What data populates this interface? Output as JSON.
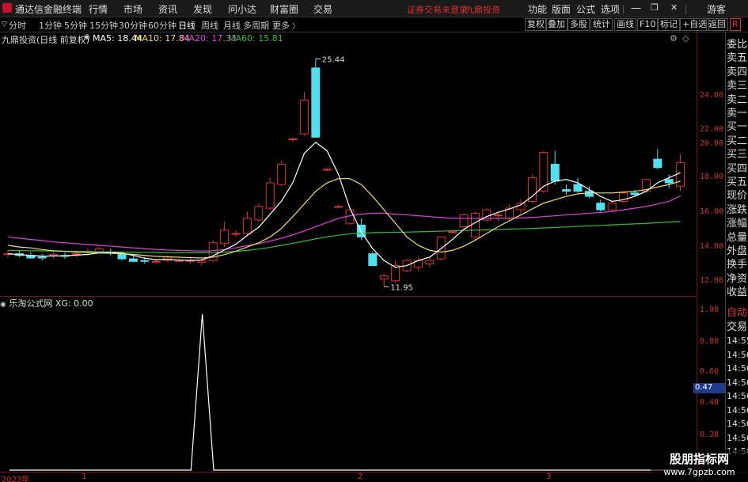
{
  "app": {
    "name": "通达信金融终端",
    "menus": [
      "行情",
      "市场",
      "资讯",
      "发现",
      "问小达",
      "财富圈",
      "交易"
    ],
    "warning": "证券交易未登录",
    "broker": "九鼎投资",
    "right_menus": [
      "功能",
      "版面",
      "公式",
      "选项"
    ],
    "user": "游客",
    "r_badge": "R"
  },
  "toolbar": {
    "periods": [
      "分时",
      "1分钟",
      "5分钟",
      "15分钟",
      "30分钟",
      "60分钟",
      "日线",
      "周线",
      "月线",
      "多周期",
      "更多"
    ],
    "active_period": "日线",
    "right_buttons": [
      "复权",
      "叠加",
      "多股",
      "统计",
      "画线",
      "F10",
      "标记",
      "+自选",
      "返回"
    ]
  },
  "info": {
    "title": "九鼎投资(日线 前复权)",
    "ma5": "MA5: 18.44",
    "ma10": "MA10: 17.84",
    "ma20": "MA20: 17.33",
    "ma60": "MA60: 15.81"
  },
  "colors": {
    "ma5": "#ffffff",
    "ma10": "#f0e060",
    "ma20": "#e040e0",
    "ma60": "#30c030",
    "up": "#e03030",
    "down": "#50e0f0",
    "axis": "#d03030"
  },
  "axis_labels": {
    "main": [
      "24.00",
      "22.00",
      "20.00",
      "18.00",
      "16.00",
      "14.00",
      "12.00"
    ],
    "sub": [
      "1.00",
      "0.80",
      "0.60",
      "0.40",
      "0.20"
    ]
  },
  "annotations": {
    "high": "25.44",
    "low": "11.95"
  },
  "sub": {
    "title": "乐淘公式网 XG: 0.00",
    "cursor_value": "0.47"
  },
  "side_panel": {
    "items": [
      "委比",
      "卖五",
      "卖四",
      "卖三",
      "卖二",
      "卖一",
      "买一",
      "买二",
      "买三",
      "买四",
      "买五",
      "现价",
      "涨跌",
      "涨幅",
      "总量",
      "外盘",
      "换手",
      "净资",
      "收益"
    ],
    "auto_label": "自动",
    "trade_label": "交易",
    "times": [
      "14:55",
      "14:56",
      "14:56",
      "14:56",
      "14:56",
      "14:56",
      "14:56",
      "14:56",
      "14:56"
    ]
  },
  "dates": [
    "2023年",
    "1",
    "2",
    "3"
  ],
  "watermark": {
    "line1": "股朋指标网",
    "line2": "www.7gpzb.com"
  },
  "chart_data": {
    "type": "candlestick",
    "ylim": [
      11.4,
      26.3
    ],
    "candles": [
      {
        "o": 13.9,
        "h": 14.1,
        "l": 13.7,
        "c": 13.9
      },
      {
        "o": 13.9,
        "h": 14.1,
        "l": 13.7,
        "c": 13.8
      },
      {
        "o": 13.8,
        "h": 14.0,
        "l": 13.6,
        "c": 13.65
      },
      {
        "o": 13.7,
        "h": 13.9,
        "l": 13.5,
        "c": 13.65
      },
      {
        "o": 13.8,
        "h": 14.0,
        "l": 13.6,
        "c": 13.85
      },
      {
        "o": 13.8,
        "h": 14.0,
        "l": 13.6,
        "c": 13.75
      },
      {
        "o": 13.9,
        "h": 14.1,
        "l": 13.7,
        "c": 13.9
      },
      {
        "o": 14.0,
        "h": 14.2,
        "l": 13.8,
        "c": 14.05
      },
      {
        "o": 14.0,
        "h": 14.3,
        "l": 13.9,
        "c": 14.2
      },
      {
        "o": 14.0,
        "h": 14.2,
        "l": 13.8,
        "c": 13.95
      },
      {
        "o": 13.9,
        "h": 14.0,
        "l": 13.5,
        "c": 13.6
      },
      {
        "o": 13.6,
        "h": 13.8,
        "l": 13.4,
        "c": 13.45
      },
      {
        "o": 13.5,
        "h": 13.7,
        "l": 13.3,
        "c": 13.45
      },
      {
        "o": 13.4,
        "h": 13.6,
        "l": 13.3,
        "c": 13.45
      },
      {
        "o": 13.5,
        "h": 13.8,
        "l": 13.4,
        "c": 13.7
      },
      {
        "o": 13.5,
        "h": 13.7,
        "l": 13.4,
        "c": 13.5
      },
      {
        "o": 13.5,
        "h": 13.7,
        "l": 13.3,
        "c": 13.5
      },
      {
        "o": 13.4,
        "h": 13.6,
        "l": 13.2,
        "c": 13.5
      },
      {
        "o": 13.5,
        "h": 14.7,
        "l": 13.4,
        "c": 14.55
      },
      {
        "o": 14.5,
        "h": 15.8,
        "l": 14.3,
        "c": 15.3
      },
      {
        "o": 15.1,
        "h": 15.3,
        "l": 14.9,
        "c": 15.1
      },
      {
        "o": 15.1,
        "h": 16.4,
        "l": 15.0,
        "c": 16.0
      },
      {
        "o": 15.9,
        "h": 16.9,
        "l": 15.8,
        "c": 16.7
      },
      {
        "o": 16.6,
        "h": 18.4,
        "l": 16.5,
        "c": 18.1
      },
      {
        "o": 18.0,
        "h": 19.4,
        "l": 17.9,
        "c": 19.2
      },
      {
        "o": 20.7,
        "h": 20.8,
        "l": 20.5,
        "c": 20.7
      },
      {
        "o": 21.0,
        "h": 23.5,
        "l": 20.9,
        "c": 23.0
      },
      {
        "o": 24.9,
        "h": 25.44,
        "l": 20.8,
        "c": 20.8
      },
      {
        "o": 18.9,
        "h": 19.0,
        "l": 18.8,
        "c": 18.9
      },
      {
        "o": 16.7,
        "h": 16.8,
        "l": 16.6,
        "c": 16.7
      },
      {
        "o": 15.7,
        "h": 16.6,
        "l": 15.6,
        "c": 16.5
      },
      {
        "o": 15.6,
        "h": 16.0,
        "l": 14.7,
        "c": 14.9
      },
      {
        "o": 13.9,
        "h": 14.0,
        "l": 13.2,
        "c": 13.2
      },
      {
        "o": 12.4,
        "h": 12.7,
        "l": 11.95,
        "c": 12.6
      },
      {
        "o": 12.3,
        "h": 13.5,
        "l": 12.2,
        "c": 13.2
      },
      {
        "o": 12.9,
        "h": 13.6,
        "l": 12.8,
        "c": 13.5
      },
      {
        "o": 13.1,
        "h": 13.7,
        "l": 12.9,
        "c": 13.5
      },
      {
        "o": 13.3,
        "h": 13.7,
        "l": 13.1,
        "c": 13.5
      },
      {
        "o": 13.6,
        "h": 14.9,
        "l": 13.5,
        "c": 14.9
      },
      {
        "o": 15.2,
        "h": 15.3,
        "l": 15.1,
        "c": 15.2
      },
      {
        "o": 15.5,
        "h": 16.3,
        "l": 15.4,
        "c": 16.2
      },
      {
        "o": 14.9,
        "h": 16.4,
        "l": 14.7,
        "c": 16.3
      },
      {
        "o": 15.9,
        "h": 16.6,
        "l": 15.8,
        "c": 16.5
      },
      {
        "o": 16.2,
        "h": 16.4,
        "l": 15.8,
        "c": 16.2
      },
      {
        "o": 16.0,
        "h": 16.8,
        "l": 15.9,
        "c": 16.6
      },
      {
        "o": 16.5,
        "h": 17.1,
        "l": 16.3,
        "c": 16.9
      },
      {
        "o": 17.0,
        "h": 18.6,
        "l": 16.9,
        "c": 18.4
      },
      {
        "o": 17.6,
        "h": 20.0,
        "l": 17.5,
        "c": 19.9
      },
      {
        "o": 19.2,
        "h": 20.0,
        "l": 18.0,
        "c": 18.2
      },
      {
        "o": 17.7,
        "h": 18.0,
        "l": 17.4,
        "c": 17.6
      },
      {
        "o": 18.0,
        "h": 18.4,
        "l": 17.5,
        "c": 17.6
      },
      {
        "o": 17.6,
        "h": 17.9,
        "l": 17.2,
        "c": 17.3
      },
      {
        "o": 16.9,
        "h": 17.1,
        "l": 16.4,
        "c": 16.5
      },
      {
        "o": 16.5,
        "h": 17.0,
        "l": 16.4,
        "c": 16.9
      },
      {
        "o": 17.0,
        "h": 17.6,
        "l": 16.9,
        "c": 17.5
      },
      {
        "o": 17.5,
        "h": 17.7,
        "l": 17.3,
        "c": 17.4
      },
      {
        "o": 17.6,
        "h": 18.3,
        "l": 17.5,
        "c": 18.3
      },
      {
        "o": 19.5,
        "h": 20.1,
        "l": 18.9,
        "c": 19.0
      },
      {
        "o": 18.3,
        "h": 18.6,
        "l": 17.8,
        "c": 18.1
      },
      {
        "o": 17.9,
        "h": 19.8,
        "l": 17.6,
        "c": 19.3
      }
    ],
    "ma5": [
      13.9,
      13.85,
      13.8,
      13.76,
      13.77,
      13.78,
      13.82,
      13.86,
      13.95,
      13.97,
      13.95,
      13.8,
      13.64,
      13.55,
      13.58,
      13.53,
      13.51,
      13.53,
      13.78,
      14.13,
      14.46,
      14.99,
      15.47,
      16.24,
      17.02,
      18.11,
      19.84,
      20.5,
      20.0,
      18.6,
      16.6,
      15.2,
      14.2,
      13.5,
      13.1,
      13.2,
      13.5,
      13.7,
      14.2,
      14.75,
      15.35,
      15.75,
      16.1,
      16.35,
      16.55,
      16.8,
      17.3,
      17.9,
      18.2,
      18.3,
      18.1,
      17.7,
      17.3,
      17.0,
      17.1,
      17.3,
      17.6,
      18.1,
      18.4,
      18.7
    ],
    "ma10": [
      14.4,
      14.3,
      14.25,
      14.15,
      14.08,
      14.05,
      14.0,
      13.98,
      13.95,
      13.93,
      13.9,
      13.86,
      13.8,
      13.75,
      13.72,
      13.7,
      13.67,
      13.65,
      13.7,
      13.85,
      14.05,
      14.3,
      14.55,
      14.9,
      15.4,
      16.1,
      16.85,
      17.6,
      18.1,
      18.35,
      18.35,
      18.0,
      17.3,
      16.5,
      15.7,
      14.9,
      14.4,
      14.1,
      14.0,
      14.1,
      14.35,
      14.7,
      15.1,
      15.5,
      15.85,
      16.2,
      16.55,
      16.9,
      17.1,
      17.3,
      17.45,
      17.5,
      17.5,
      17.5,
      17.55,
      17.6,
      17.7,
      17.85,
      18.0,
      18.2
    ],
    "ma20": [
      14.9,
      14.82,
      14.75,
      14.68,
      14.6,
      14.55,
      14.5,
      14.45,
      14.4,
      14.35,
      14.3,
      14.25,
      14.2,
      14.16,
      14.12,
      14.1,
      14.08,
      14.06,
      14.08,
      14.15,
      14.25,
      14.38,
      14.5,
      14.65,
      14.82,
      15.02,
      15.25,
      15.5,
      15.75,
      16.0,
      16.15,
      16.25,
      16.3,
      16.3,
      16.25,
      16.2,
      16.15,
      16.1,
      16.05,
      16.0,
      16.0,
      16.0,
      16.0,
      16.0,
      16.0,
      16.02,
      16.05,
      16.1,
      16.15,
      16.2,
      16.25,
      16.3,
      16.35,
      16.4,
      16.5,
      16.6,
      16.7,
      16.85,
      17.0,
      17.33
    ],
    "ma60": [
      14.1,
      14.09,
      14.08,
      14.07,
      14.06,
      14.05,
      14.04,
      14.03,
      14.02,
      14.01,
      14.0,
      13.99,
      13.98,
      13.97,
      13.97,
      13.96,
      13.96,
      13.96,
      13.97,
      14.0,
      14.04,
      14.1,
      14.18,
      14.28,
      14.4,
      14.52,
      14.65,
      14.78,
      14.9,
      15.0,
      15.08,
      15.12,
      15.15,
      15.16,
      15.17,
      15.18,
      15.2,
      15.22,
      15.24,
      15.26,
      15.28,
      15.3,
      15.32,
      15.34,
      15.36,
      15.38,
      15.4,
      15.43,
      15.46,
      15.49,
      15.52,
      15.55,
      15.58,
      15.61,
      15.64,
      15.67,
      15.7,
      15.74,
      15.78,
      15.81
    ],
    "xg": {
      "type": "line",
      "ylim": [
        0,
        1.0
      ],
      "signal_index": 17,
      "values_default": 0
    }
  }
}
